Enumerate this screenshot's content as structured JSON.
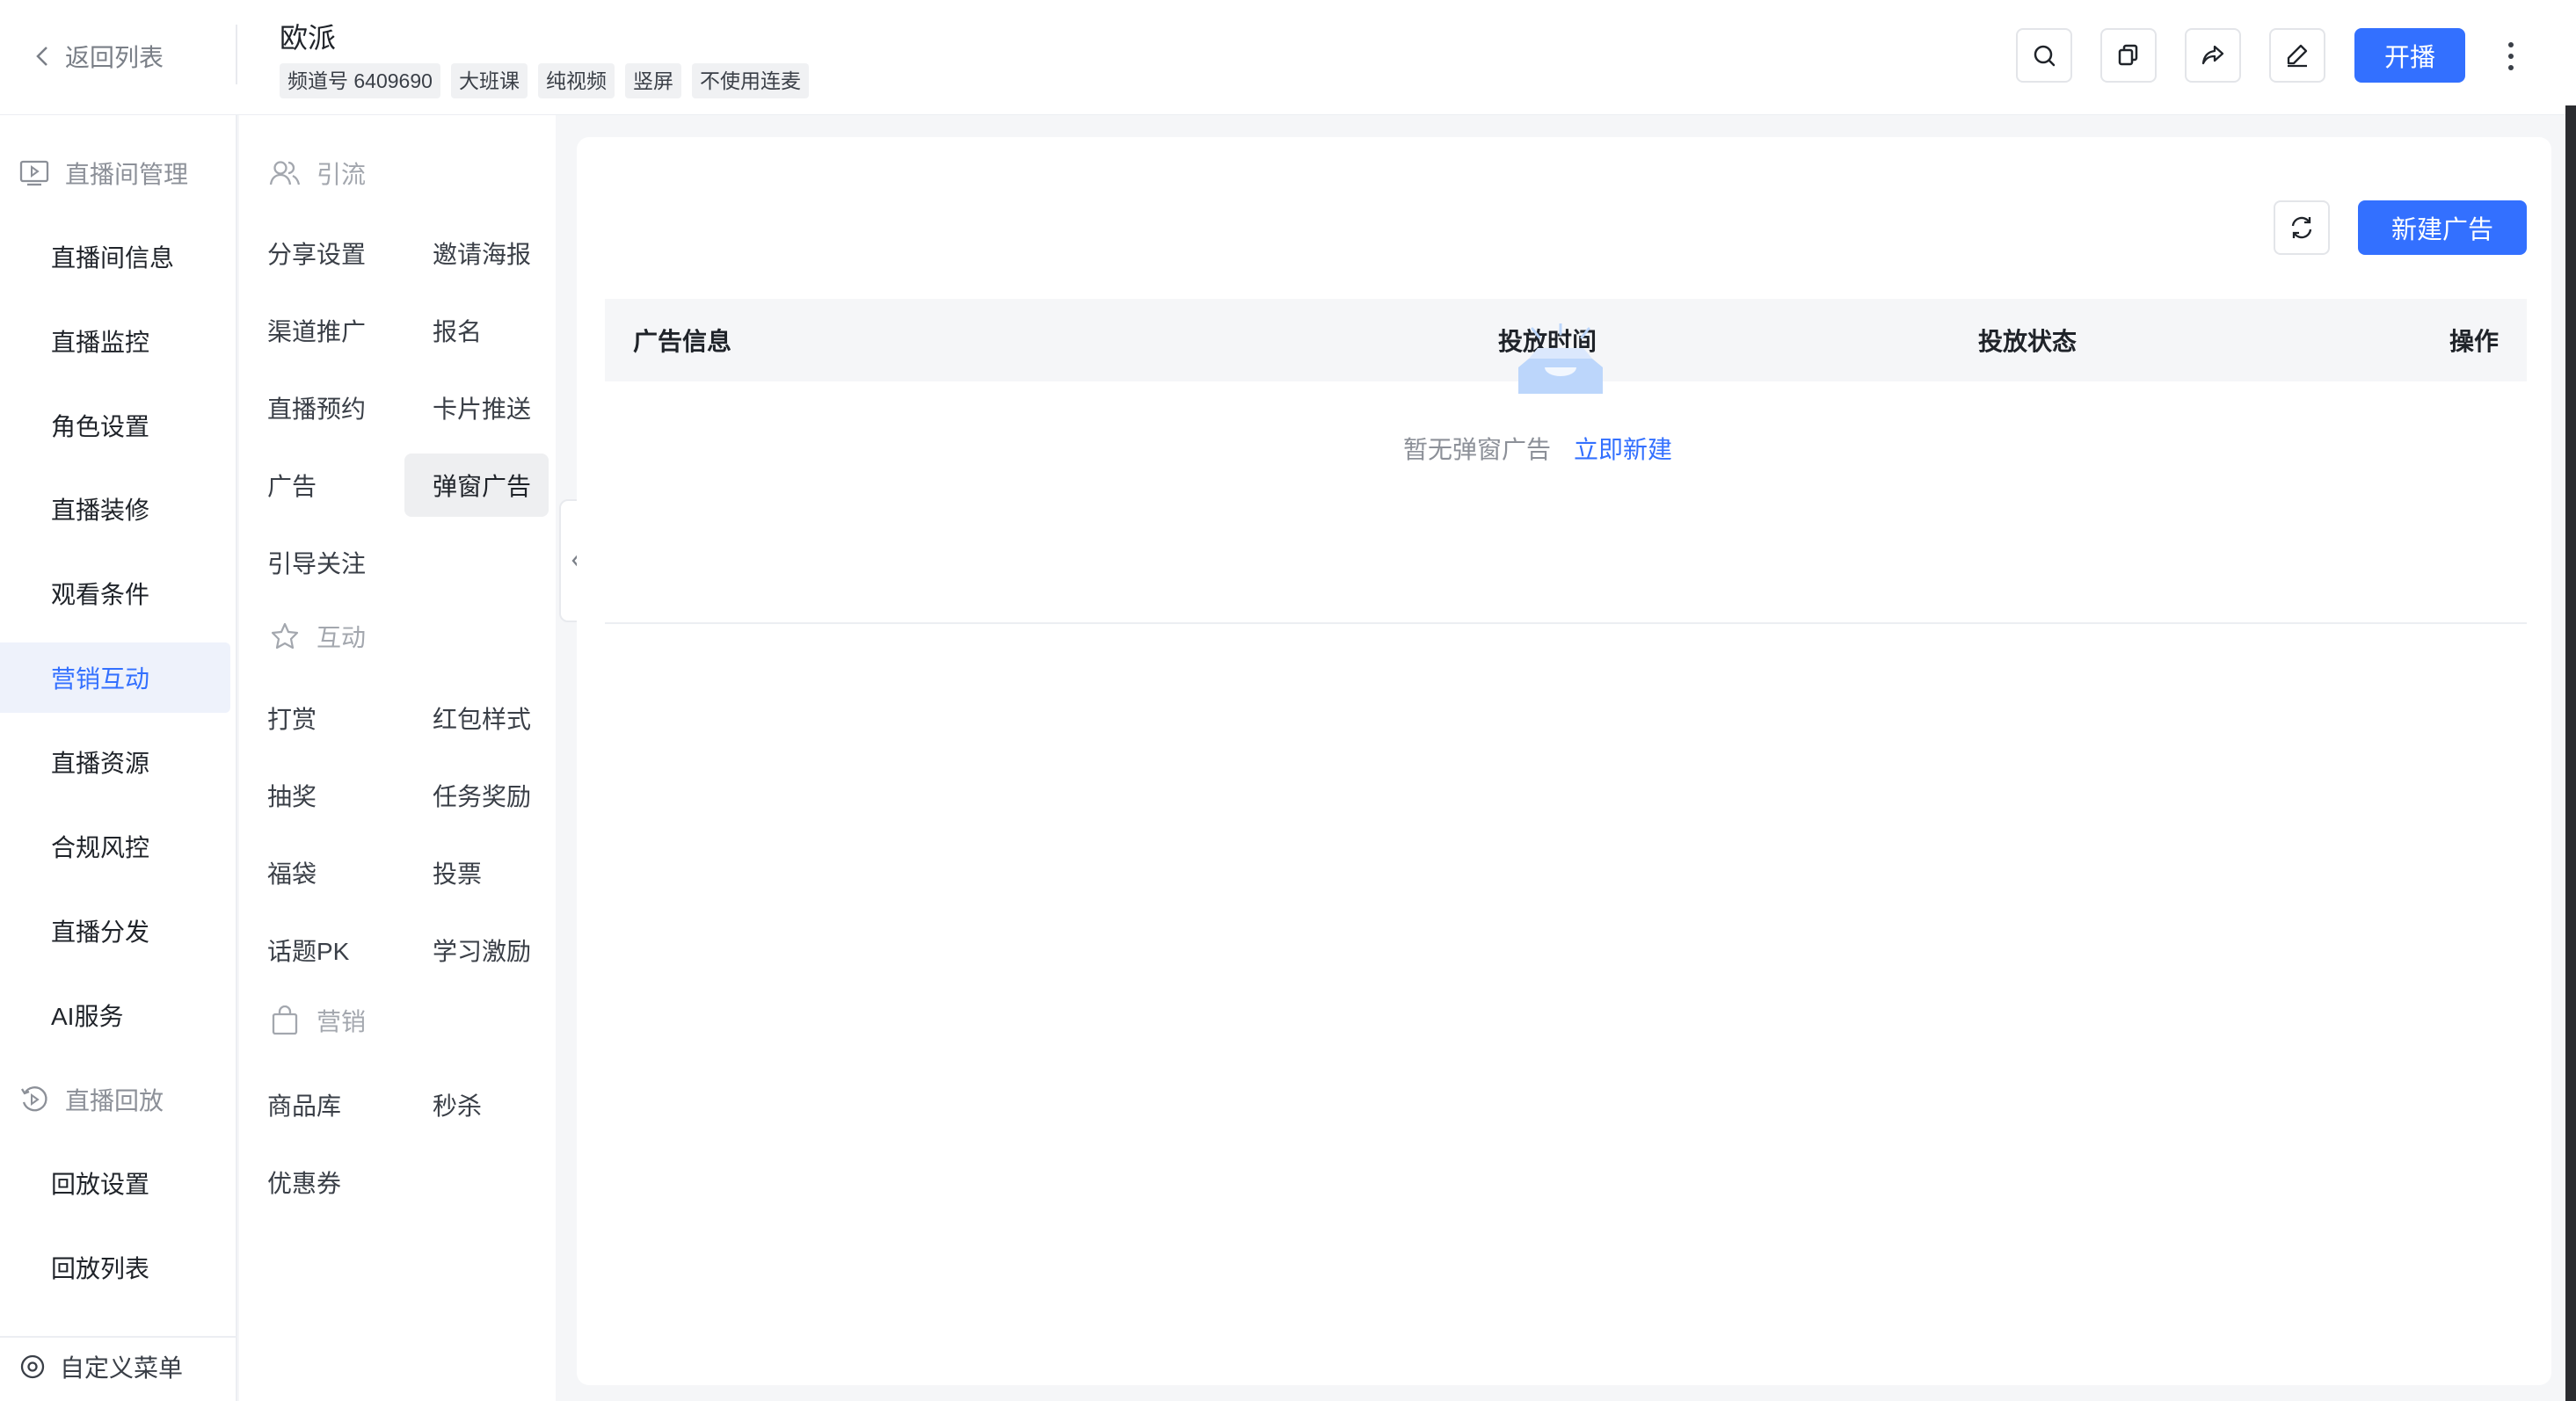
{
  "header": {
    "back_label": "返回列表",
    "title": "欧派",
    "tags": [
      "频道号 6409690",
      "大班课",
      "纯视频",
      "竖屏",
      "不使用连麦"
    ],
    "start_live_label": "开播",
    "icons": [
      "search-icon",
      "copy-icon",
      "share-icon",
      "edit-icon",
      "more-icon"
    ]
  },
  "sidebar": {
    "group_live_room": "直播间管理",
    "items": [
      "直播间信息",
      "直播监控",
      "角色设置",
      "直播装修",
      "观看条件",
      "营销互动",
      "直播资源",
      "合规风控",
      "直播分发",
      "AI服务"
    ],
    "active_item": "营销互动",
    "group_playback": "直播回放",
    "playback_items": [
      "回放设置",
      "回放列表"
    ],
    "custom_menu": "自定义菜单"
  },
  "subnav": {
    "group_traffic": "引流",
    "traffic_items": [
      "分享设置",
      "邀请海报",
      "渠道推广",
      "报名",
      "直播预约",
      "卡片推送",
      "广告",
      "弹窗广告",
      "引导关注"
    ],
    "group_interact": "互动",
    "interact_items": [
      "打赏",
      "红包样式",
      "抽奖",
      "任务奖励",
      "福袋",
      "投票",
      "话题PK",
      "学习激励"
    ],
    "group_marketing": "营销",
    "marketing_items": [
      "商品库",
      "秒杀",
      "优惠券"
    ],
    "active_item": "弹窗广告"
  },
  "main": {
    "new_ad_label": "新建广告",
    "columns": [
      "广告信息",
      "投放时间",
      "投放状态",
      "操作"
    ],
    "empty_message": "暂无弹窗广告",
    "empty_action": "立即新建"
  },
  "colors": {
    "primary": "#3370ff",
    "active_bg": "#eef2fb",
    "empty_icon": "#bcd6fb"
  }
}
